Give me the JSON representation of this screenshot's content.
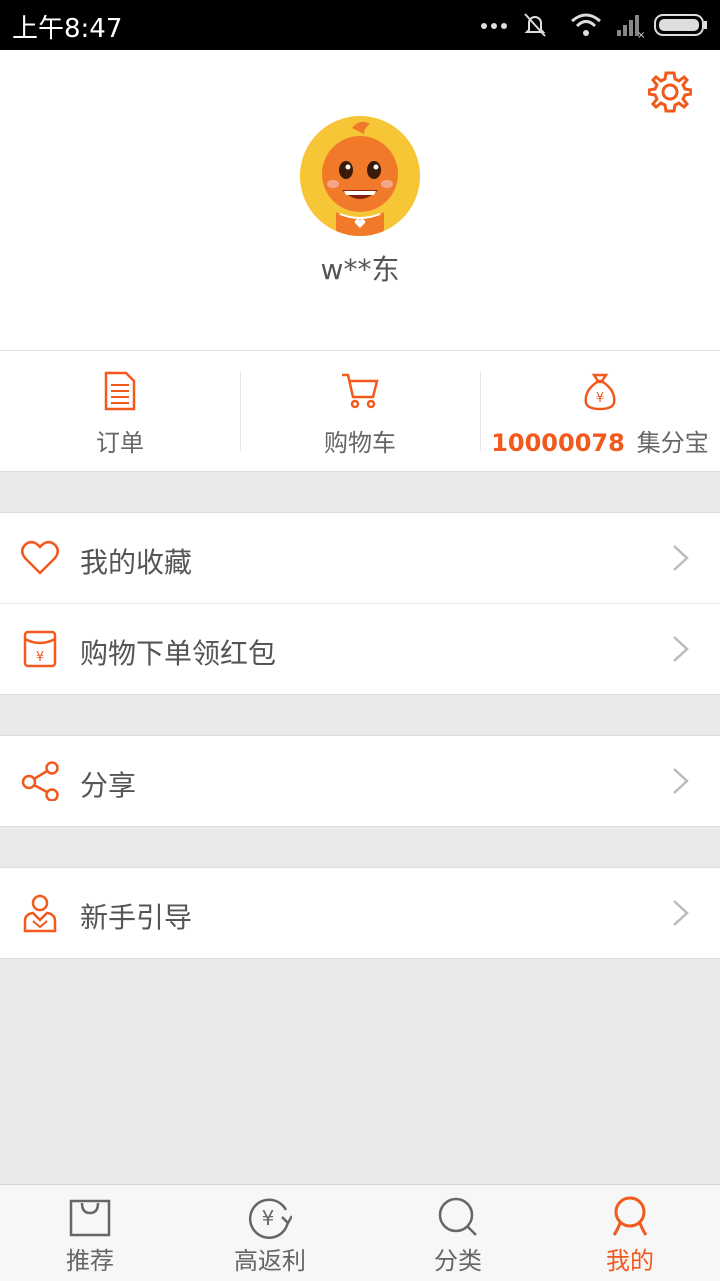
{
  "status_bar": {
    "time": "上午8:47"
  },
  "profile": {
    "username": "w**东"
  },
  "quick_actions": [
    {
      "label": "订单",
      "icon": "document-icon"
    },
    {
      "label": "购物车",
      "icon": "cart-icon"
    },
    {
      "points": "10000078",
      "label": "集分宝",
      "icon": "money-bag-icon"
    }
  ],
  "menu": {
    "favorites": "我的收藏",
    "red_packet": "购物下单领红包",
    "share": "分享",
    "guide": "新手引导"
  },
  "bottom_nav": [
    {
      "label": "推荐",
      "icon": "shopping-bag-icon"
    },
    {
      "label": "高返利",
      "icon": "yen-cycle-icon"
    },
    {
      "label": "分类",
      "icon": "search-icon"
    },
    {
      "label": "我的",
      "icon": "profile-icon",
      "active": true
    }
  ],
  "colors": {
    "accent": "#f2591d",
    "background": "#ebeaeb"
  }
}
